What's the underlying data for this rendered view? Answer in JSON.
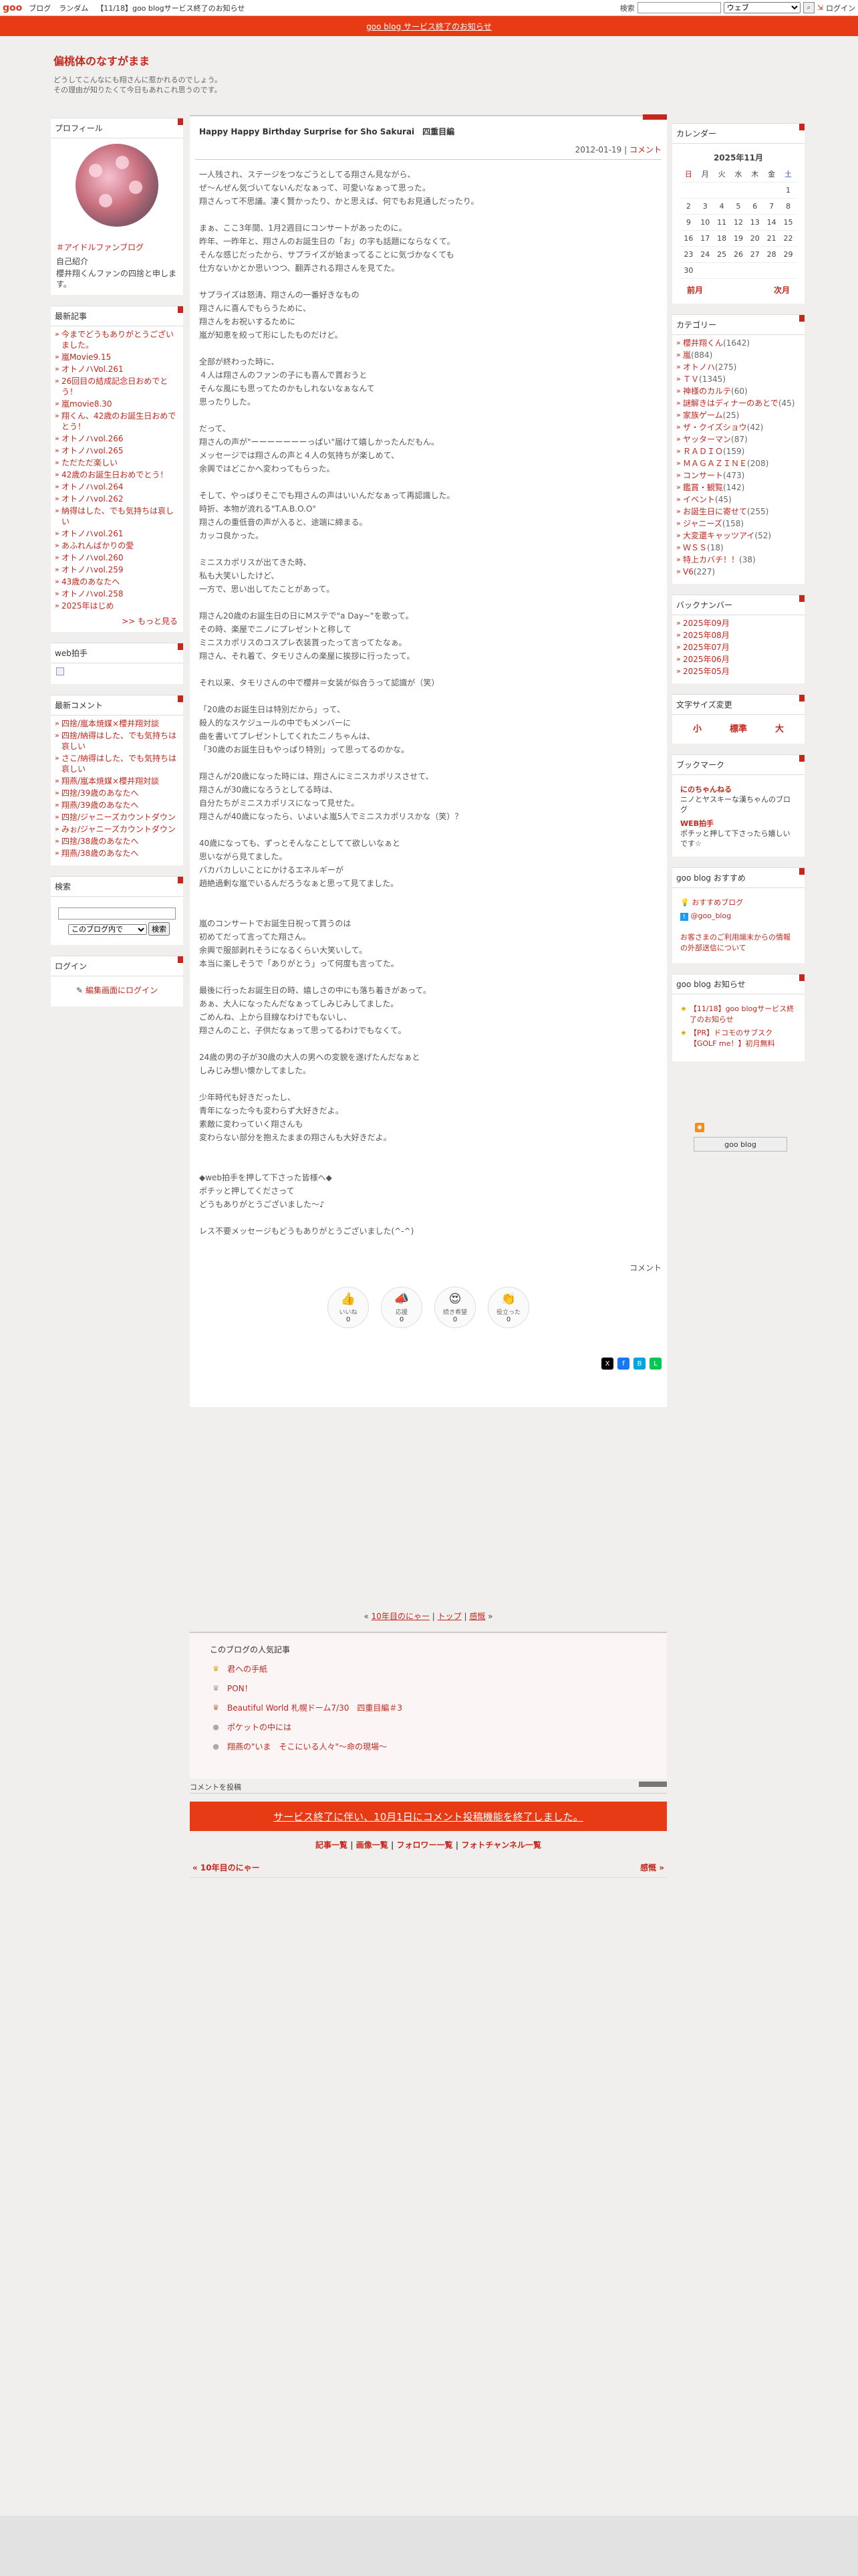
{
  "gnav": {
    "logo": "goo",
    "links": [
      "ブログ",
      "ランダム",
      "【11/18】goo blogサービス終了のお知らせ"
    ],
    "search_label": "検索",
    "search_value": "",
    "search_scope": "ウェブ",
    "login": "ログイン"
  },
  "notice": {
    "text": "goo blog サービス終了のお知らせ"
  },
  "blog": {
    "title": "偏桃体のなすがまま",
    "desc1": "どうしてこんなにも翔さんに惹かれるのでしょう。",
    "desc2": "その理由が知りたくて今日もあれこれ思うのです。"
  },
  "profile": {
    "heading": "プロフィール",
    "account": "＃アイドルファンブログ",
    "intro_label": "自己紹介",
    "intro": "櫻井翔くんファンの四捨と申します。"
  },
  "recent": {
    "heading": "最新記事",
    "items": [
      "今までどうもありがとうございました。",
      "嵐Movie9.15",
      "オトノハVol.261",
      "26回目の結成記念日おめでとう！",
      "嵐movie8.30",
      "翔くん、42歳のお誕生日おめでとう！",
      "オトノハvol.266",
      "オトノハvol.265",
      "ただただ楽しい",
      "42歳のお誕生日おめでとう！",
      "オトノハvol.264",
      "オトノハvol.262",
      "納得はした、でも気持ちは哀しい",
      "オトノハvol.261",
      "あふれんばかりの愛",
      "オトノハvol.260",
      "オトノハvol.259",
      "43歳のあなたへ",
      "オトノハvol.258",
      "2025年はじめ"
    ],
    "more": ">> もっと見る"
  },
  "webclap": {
    "heading": "web拍手"
  },
  "comments": {
    "heading": "最新コメント",
    "items": [
      "四捨/嵐本焼媒×櫻井翔対談",
      "四捨/納得はした、でも気持ちは哀しい",
      "さこ/納得はした、でも気持ちは哀しい",
      "翔燕/嵐本焼媒×櫻井翔対談",
      "四捨/39歳のあなたへ",
      "翔燕/39歳のあなたへ",
      "四捨/ジャニーズカウントダウン",
      "みぉ/ジャニーズカウントダウン",
      "四捨/38歳のあなたへ",
      "翔燕/38歳のあなたへ"
    ]
  },
  "search": {
    "heading": "検索",
    "scope": "このブログ内で",
    "button": "検索"
  },
  "login": {
    "heading": "ログイン",
    "link": "編集画面にログイン"
  },
  "entry": {
    "title": "Happy Happy Birthday Surprise for Sho Sakurai　四重目編",
    "date": "2012-01-19",
    "comment_link": "コメント",
    "body": "一人残され、ステージをつなごうとしてる翔さん見ながら、\nぜ～んぜん気づいてないんだなぁって、可愛いなぁって思った。\n翔さんって不思議。凄く賢かったり、かと思えば、何でもお見通しだったり。\n\nまぁ、ここ3年間、1月2週目にコンサートがあったのに。\n昨年、一昨年と、翔さんのお誕生日の「お」の字も話題にならなくて。\nそんな感じだったから、サプライズが始まってることに気づかなくても\n仕方ないかとか思いつつ、翻弄される翔さんを見てた。\n\nサプライズは怒涛、翔さんの一番好きなもの\n翔さんに喜んでもらうために、\n翔さんをお祝いするために\n嵐が知恵を絞って形にしたものだけど。\n\n全部が終わった時に、\n４人は翔さんのファンの子にも喜んで貰おうと\nそんな風にも思ってたのかもしれないなぁなんて\n思ったりした。\n\nだって、\n翔さんの声が\"ーーーーーーーっぱい\"届けて嬉しかったんだもん。\nメッセージでは翔さんの声と４人の気持ちが楽しめて、\n余興ではどこかへ変わってもらった。\n\nそして、やっぱりそこでも翔さんの声はいいんだなぁって再認識した。\n時折、本物が流れる\"T.A.B.O.O\"\n翔さんの重低音の声が入ると、途端に締まる。\nカッコ良かった。\n\nミニスカポリスが出てきた時、\n私も大笑いしたけど、\n一方で、思い出してたことがあって。\n\n翔さん20歳のお誕生日の日にMステで\"a Day~\"を歌って。\nその時、楽屋でニノにプレゼントと称して\nミニスカポリスのコスプレ衣装貰ったって言ってたなぁ。\n翔さん、それ着て、タモリさんの楽屋に挨拶に行ったって。\n\nそれ以来、タモリさんの中で櫻井＝女装が似合うって認識が（笑）\n\n「20歳のお誕生日は特別だから」って、\n殺人的なスケジュールの中でもメンバーに\n曲を書いてプレゼントしてくれたニノちゃんは、\n「30歳のお誕生日もやっぱり特別」って思ってるのかな。\n\n翔さんが20歳になった時には、翔さんにミニスカポリスさせて、\n翔さんが30歳になろうとしてる時は、\n自分たちがミニスカポリスになって見せた。\n翔さんが40歳になったら、いよいよ嵐5人でミニスカポリスかな（笑）？\n\n40歳になっても、ずっとそんなことしてて欲しいなぁと\n思いながら見てました。\nバカバカしいことにかけるエネルギーが\n趙絶過剰な嵐でいるんだろうなぁと思って見てました。\n\n\n嵐のコンサートでお誕生日祝って貰うのは\n初めてだって言ってた翔さん。\n余興で服部剥れそうになるくらい大笑いして。\n本当に楽しそうで「ありがとう」って何度も言ってた。\n\n最後に行ったお誕生日の時、嬉しさの中にも落ち着きがあって。\nあぁ、大人になったんだなぁってしみじみしてました。\nごめんね、上から目線なわけでもないし、\n翔さんのこと、子供だなぁって思ってるわけでもなくて。\n\n24歳の男の子が30歳の大人の男への変貌を遂げたんだなぁと\nしみじみ想い懐かしてました。\n\n少年時代も好きだったし、\n青年になった今も変わらず大好きだよ。\n素敵に変わっていく翔さんも\n変わらない部分を抱えたままの翔さんも大好きだよ。\n\n\n◆web拍手を押して下さった皆様へ◆\nポチッと押してくださって\nどうもありがとうございました～♪\n\nレス不要メッセージもどうもありがとうございました(^-^)",
    "comment_label": "コメント"
  },
  "reactions": [
    {
      "label": "いいね",
      "count": "0"
    },
    {
      "label": "応援",
      "count": "0"
    },
    {
      "label": "続き希望",
      "count": "0"
    },
    {
      "label": "役立った",
      "count": "0"
    }
  ],
  "pager": {
    "prev": "10年目のにゃー",
    "top": "トップ",
    "next": "感慨"
  },
  "popular": {
    "heading": "このブログの人気記事",
    "items": [
      "君への手紙",
      "PON！",
      "Beautiful World 札幌ドーム7/30　四重目編＃3",
      "ポケットの中には",
      "翔燕の\"いま　そこにいる人々\"〜命の現場〜"
    ]
  },
  "post_comment": {
    "label": "コメントを投稿"
  },
  "endnotice": {
    "text": "サービス終了に伴い、10月1日にコメント投稿機能を終了しました。"
  },
  "bottom_links": [
    "記事一覧",
    "画像一覧",
    "フォロワー一覧",
    "フォトチャンネル一覧"
  ],
  "prevnext": {
    "prev": "« 10年目のにゃー",
    "next": "感慨 »"
  },
  "calendar": {
    "heading": "カレンダー",
    "ym": "2025年11月",
    "days": [
      "日",
      "月",
      "火",
      "水",
      "木",
      "金",
      "土"
    ],
    "weeks": [
      [
        "",
        "",
        "",
        "",
        "",
        "",
        "1"
      ],
      [
        "2",
        "3",
        "4",
        "5",
        "6",
        "7",
        "8"
      ],
      [
        "9",
        "10",
        "11",
        "12",
        "13",
        "14",
        "15"
      ],
      [
        "16",
        "17",
        "18",
        "19",
        "20",
        "21",
        "22"
      ],
      [
        "23",
        "24",
        "25",
        "26",
        "27",
        "28",
        "29"
      ],
      [
        "30",
        "",
        "",
        "",
        "",
        "",
        ""
      ]
    ],
    "prev": "前月",
    "next": "次月"
  },
  "category": {
    "heading": "カテゴリー",
    "items": [
      {
        "name": "櫻井翔くん",
        "count": "(1642)"
      },
      {
        "name": "嵐",
        "count": "(884)"
      },
      {
        "name": "オトノハ",
        "count": "(275)"
      },
      {
        "name": "ＴＶ",
        "count": "(1345)"
      },
      {
        "name": "神様のカルテ",
        "count": "(60)"
      },
      {
        "name": "謎解きはディナーのあとで",
        "count": "(45)"
      },
      {
        "name": "家族ゲーム",
        "count": "(25)"
      },
      {
        "name": "ザ・クイズショウ",
        "count": "(42)"
      },
      {
        "name": "ヤッターマン",
        "count": "(87)"
      },
      {
        "name": "ＲＡＤＩＯ",
        "count": "(159)"
      },
      {
        "name": "ＭＡＧＡＺＩＮＥ",
        "count": "(208)"
      },
      {
        "name": "コンサート",
        "count": "(473)"
      },
      {
        "name": "鑑賞・観覧",
        "count": "(142)"
      },
      {
        "name": "イベント",
        "count": "(45)"
      },
      {
        "name": "お誕生日に寄せて",
        "count": "(255)"
      },
      {
        "name": "ジャニーズ",
        "count": "(158)"
      },
      {
        "name": "大変還キャッツアイ",
        "count": "(52)"
      },
      {
        "name": "ＷＳＳ",
        "count": "(18)"
      },
      {
        "name": "特上カバチ！！",
        "count": "(38)"
      },
      {
        "name": "V6",
        "count": "(227)"
      }
    ]
  },
  "backnumber": {
    "heading": "バックナンバー",
    "items": [
      "2025年09月",
      "2025年08月",
      "2025年07月",
      "2025年06月",
      "2025年05月"
    ]
  },
  "fontsize": {
    "heading": "文字サイズ変更",
    "small": "小",
    "normal": "標準",
    "large": "大"
  },
  "bookmark": {
    "heading": "ブックマーク",
    "items": [
      {
        "name": "にのちゃんねる",
        "desc": "ニノとヤスキーな漢ちゃんのブログ"
      },
      {
        "name": "WEB拍手",
        "desc": "ポチッと押して下さったら嬉しいです☆"
      }
    ]
  },
  "recommend": {
    "heading": "goo blog おすすめ",
    "items": [
      "おすすめブログ",
      "@goo_blog"
    ],
    "warn": "お客さまのご利用端末からの情報の外部送信について"
  },
  "gooinfo": {
    "heading": "goo blog お知らせ",
    "items": [
      "【11/18】goo blogサービス終了のお知らせ",
      "【PR】ドコモのサブスク【GOLF me！】初月無料"
    ]
  },
  "goo_btn": "goo blog",
  "colors": {
    "accent": "#c2281e",
    "notice": "#e73b15"
  }
}
